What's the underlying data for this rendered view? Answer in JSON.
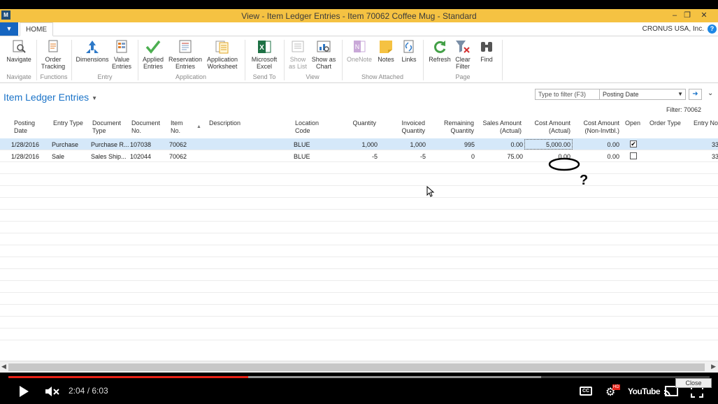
{
  "window": {
    "title": "View - Item Ledger Entries - Item 70062 Coffee Mug - Standard",
    "logo_text": "M"
  },
  "tabs": {
    "home": "HOME"
  },
  "company": "CRONUS USA, Inc.",
  "ribbon": {
    "buttons": {
      "navigate": "Navigate",
      "order_tracking_1": "Order",
      "order_tracking_2": "Tracking",
      "dimensions": "Dimensions",
      "value_entries_1": "Value",
      "value_entries_2": "Entries",
      "applied_entries_1": "Applied",
      "applied_entries_2": "Entries",
      "reservation_entries_1": "Reservation",
      "reservation_entries_2": "Entries",
      "application_worksheet_1": "Application",
      "application_worksheet_2": "Worksheet",
      "excel_1": "Microsoft",
      "excel_2": "Excel",
      "show_list_1": "Show",
      "show_list_2": "as List",
      "show_chart_1": "Show as",
      "show_chart_2": "Chart",
      "onenote": "OneNote",
      "notes": "Notes",
      "links": "Links",
      "refresh": "Refresh",
      "clear_filter_1": "Clear",
      "clear_filter_2": "Filter",
      "find": "Find"
    },
    "groups": {
      "navigate": "Navigate",
      "functions": "Functions",
      "entry": "Entry",
      "application": "Application",
      "send_to": "Send To",
      "view": "View",
      "show_attached": "Show Attached",
      "page": "Page"
    }
  },
  "page": {
    "title": "Item Ledger Entries",
    "filter_placeholder": "Type to filter (F3)",
    "filter_field": "Posting Date",
    "filter_label": "Filter: 70062"
  },
  "columns": {
    "posting_date_1": "Posting",
    "posting_date_2": "Date",
    "entry_type": "Entry Type",
    "document_type_1": "Document",
    "document_type_2": "Type",
    "document_no_1": "Document",
    "document_no_2": "No.",
    "item_no_1": "Item",
    "item_no_2": "No.",
    "description": "Description",
    "location_code_1": "Location",
    "location_code_2": "Code",
    "quantity": "Quantity",
    "invoiced_qty_1": "Invoiced",
    "invoiced_qty_2": "Quantity",
    "remaining_qty_1": "Remaining",
    "remaining_qty_2": "Quantity",
    "sales_amount_1": "Sales Amount",
    "sales_amount_2": "(Actual)",
    "cost_amount_1": "Cost Amount",
    "cost_amount_2": "(Actual)",
    "cost_nonin_1": "Cost Amount",
    "cost_nonin_2": "(Non-Invtbl.)",
    "open": "Open",
    "order_type": "Order Type",
    "entry_no": "Entry No"
  },
  "rows": [
    {
      "posting_date": "1/28/2016",
      "entry_type": "Purchase",
      "document_type": "Purchase R...",
      "document_no": "107038",
      "item_no": "70062",
      "description": "",
      "location": "BLUE",
      "quantity": "1,000",
      "invoiced": "1,000",
      "remaining": "995",
      "sales_amount": "0.00",
      "cost_amount": "5,000.00",
      "cost_nonin": "0.00",
      "open": true,
      "order_type": "",
      "entry_no": "33"
    },
    {
      "posting_date": "1/28/2016",
      "entry_type": "Sale",
      "document_type": "Sales Ship...",
      "document_no": "102044",
      "item_no": "70062",
      "description": "",
      "location": "BLUE",
      "quantity": "-5",
      "invoiced": "-5",
      "remaining": "0",
      "sales_amount": "75.00",
      "cost_amount": "0.00",
      "cost_nonin": "0.00",
      "open": false,
      "order_type": "",
      "entry_no": "33"
    }
  ],
  "annotation": {
    "mark": "?"
  },
  "player": {
    "time": "2:04 / 6:03",
    "progress": 0.342,
    "buffered": 0.76,
    "close_label": "Close",
    "youtube_label": "YouTube",
    "hd_badge": "HD",
    "cc_label": "CC",
    "accent": "#e62117"
  }
}
